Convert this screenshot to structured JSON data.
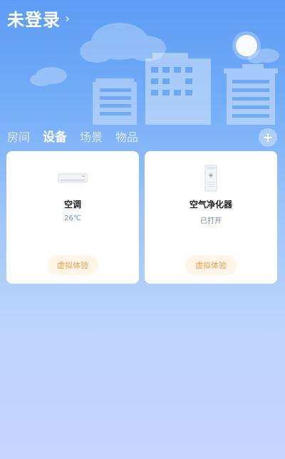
{
  "header": {
    "title": "未登录",
    "chevron": "›"
  },
  "tabs": [
    {
      "label": "房间",
      "active": false
    },
    {
      "label": "设备",
      "active": true
    },
    {
      "label": "场景",
      "active": false
    },
    {
      "label": "物品",
      "active": false
    }
  ],
  "add_button": {
    "icon": "plus-icon"
  },
  "devices": [
    {
      "name": "空调",
      "status": "26℃",
      "action": "虚拟体验",
      "icon": "air-conditioner-icon"
    },
    {
      "name": "空气净化器",
      "status": "已打开",
      "action": "虚拟体验",
      "icon": "air-purifier-icon"
    }
  ],
  "colors": {
    "bg_top": "#5d9cf5",
    "bg_bottom": "#c8d4fc",
    "action_text": "#f0a04b",
    "action_bg": "#fff5e8"
  }
}
